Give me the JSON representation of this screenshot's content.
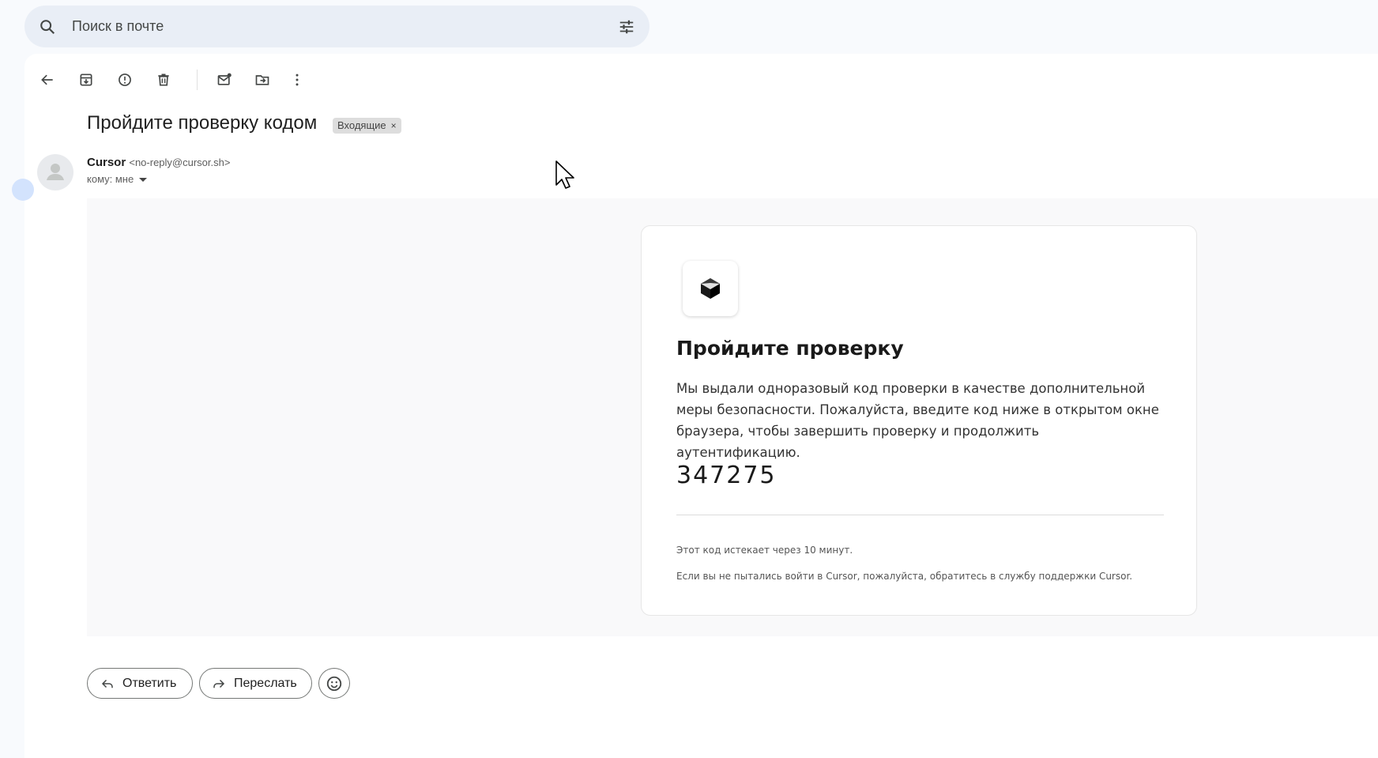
{
  "search": {
    "placeholder": "Поиск в почте",
    "icon": "search-icon",
    "filter_icon": "tune-icon"
  },
  "toolbar": {
    "buttons": [
      "back-icon",
      "archive-icon",
      "report-spam-icon",
      "delete-icon",
      "mark-unread-icon",
      "move-to-icon",
      "more-options-icon"
    ]
  },
  "message": {
    "subject": "Пройдите проверку кодом",
    "label": "Входящие",
    "label_remove": "×",
    "sender_name": "Cursor",
    "sender_email": "<no-reply@cursor.sh>",
    "to": "кому: мне"
  },
  "email_body": {
    "title": "Пройдите проверку",
    "text": "Мы выдали одноразовый код проверки в качестве дополнительной меры безопасности. Пожалуйста, введите код ниже в открытом окне браузера, чтобы завершить проверку и продолжить аутентификацию.",
    "code": "347275",
    "note_expiry": "Этот код истекает через 10 минут.",
    "note_support": "Если вы не пытались войти в Cursor, пожалуйста, обратитесь в службу поддержки Cursor."
  },
  "actions": {
    "reply_label": "Ответить",
    "forward_label": "Переслать",
    "emoji_icon": "emoji-icon"
  },
  "colors": {
    "page_bg": "#f8fafd",
    "search_bg": "#e9eef6",
    "label_bg": "#dddddd"
  }
}
